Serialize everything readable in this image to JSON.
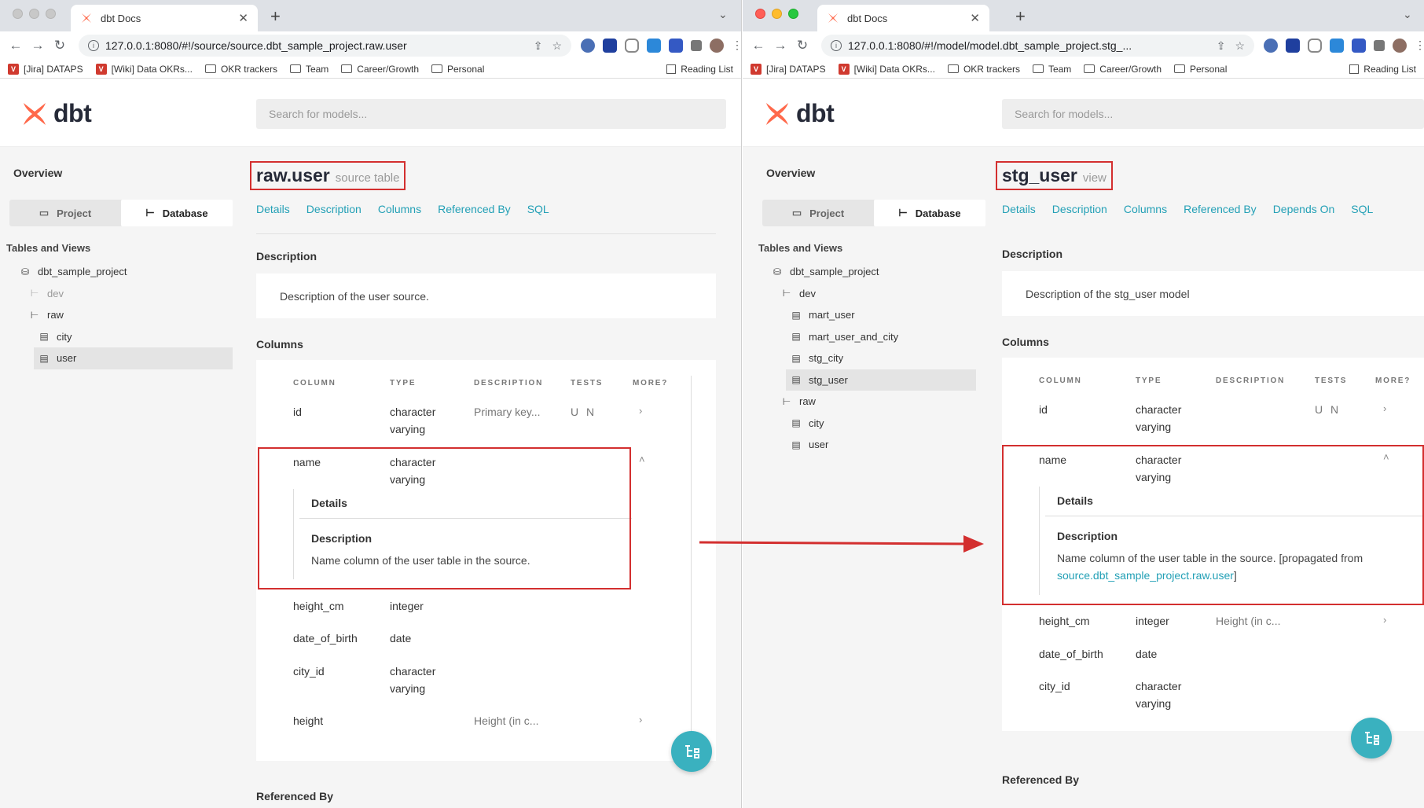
{
  "left": {
    "tab_title": "dbt Docs",
    "url": "127.0.0.1:8080/#!/source/source.dbt_sample_project.raw.user",
    "bookmarks": [
      "[Jira] DATAPS",
      "[Wiki] Data OKRs...",
      "OKR trackers",
      "Team",
      "Career/Growth",
      "Personal"
    ],
    "reading_list": "Reading List",
    "logo": "dbt",
    "search_placeholder": "Search for models...",
    "overview": "Overview",
    "seg_project": "Project",
    "seg_database": "Database",
    "tables_views": "Tables and Views",
    "tree": [
      "dbt_sample_project",
      "dev",
      "raw",
      "city",
      "user"
    ],
    "title": "raw.user",
    "subtitle": "source table",
    "nav": [
      "Details",
      "Description",
      "Columns",
      "Referenced By",
      "SQL"
    ],
    "desc_h": "Description",
    "desc_text": "Description of the user source.",
    "columns_h": "Columns",
    "col_headers": [
      "COLUMN",
      "TYPE",
      "DESCRIPTION",
      "TESTS",
      "MORE?"
    ],
    "rows": [
      {
        "name": "id",
        "type1": "character",
        "type2": "varying",
        "desc": "Primary key...",
        "tests": "U N"
      },
      {
        "name": "name",
        "type1": "character",
        "type2": "varying",
        "desc": "",
        "tests": ""
      },
      {
        "name": "height_cm",
        "type1": "integer",
        "type2": "",
        "desc": "",
        "tests": ""
      },
      {
        "name": "date_of_birth",
        "type1": "date",
        "type2": "",
        "desc": "",
        "tests": ""
      },
      {
        "name": "city_id",
        "type1": "character",
        "type2": "varying",
        "desc": "",
        "tests": ""
      },
      {
        "name": "height",
        "type1": "",
        "type2": "",
        "desc": "Height (in c...",
        "tests": ""
      }
    ],
    "details_h": "Details",
    "det_desc_h": "Description",
    "det_desc_text": "Name column of the user table in the source.",
    "referenced_by": "Referenced By"
  },
  "right": {
    "tab_title": "dbt Docs",
    "url": "127.0.0.1:8080/#!/model/model.dbt_sample_project.stg_...",
    "bookmarks": [
      "[Jira] DATAPS",
      "[Wiki] Data OKRs...",
      "OKR trackers",
      "Team",
      "Career/Growth",
      "Personal"
    ],
    "reading_list": "Reading List",
    "logo": "dbt",
    "search_placeholder": "Search for models...",
    "overview": "Overview",
    "seg_project": "Project",
    "seg_database": "Database",
    "tables_views": "Tables and Views",
    "tree": [
      "dbt_sample_project",
      "dev",
      "mart_user",
      "mart_user_and_city",
      "stg_city",
      "stg_user",
      "raw",
      "city",
      "user"
    ],
    "title": "stg_user",
    "subtitle": "view",
    "nav": [
      "Details",
      "Description",
      "Columns",
      "Referenced By",
      "Depends On",
      "SQL"
    ],
    "desc_h": "Description",
    "desc_text": "Description of the stg_user model",
    "columns_h": "Columns",
    "col_headers": [
      "COLUMN",
      "TYPE",
      "DESCRIPTION",
      "TESTS",
      "MORE?"
    ],
    "rows": [
      {
        "name": "id",
        "type1": "character",
        "type2": "varying",
        "desc": "",
        "tests": "U N"
      },
      {
        "name": "name",
        "type1": "character",
        "type2": "varying",
        "desc": "",
        "tests": ""
      },
      {
        "name": "height_cm",
        "type1": "integer",
        "type2": "",
        "desc": "Height (in c...",
        "tests": ""
      },
      {
        "name": "date_of_birth",
        "type1": "date",
        "type2": "",
        "desc": "",
        "tests": ""
      },
      {
        "name": "city_id",
        "type1": "character",
        "type2": "varying",
        "desc": "",
        "tests": ""
      }
    ],
    "details_h": "Details",
    "det_desc_h": "Description",
    "det_desc_text": "Name column of the user table in the source. [propagated from",
    "det_desc_link": "source.dbt_sample_project.raw.user",
    "det_desc_close": "]",
    "referenced_by": "Referenced By"
  },
  "colors": {
    "accent": "#23a0b6",
    "highlight": "#d32f2f",
    "dbt_orange": "#ff694b",
    "fab": "#3ab1bf"
  }
}
